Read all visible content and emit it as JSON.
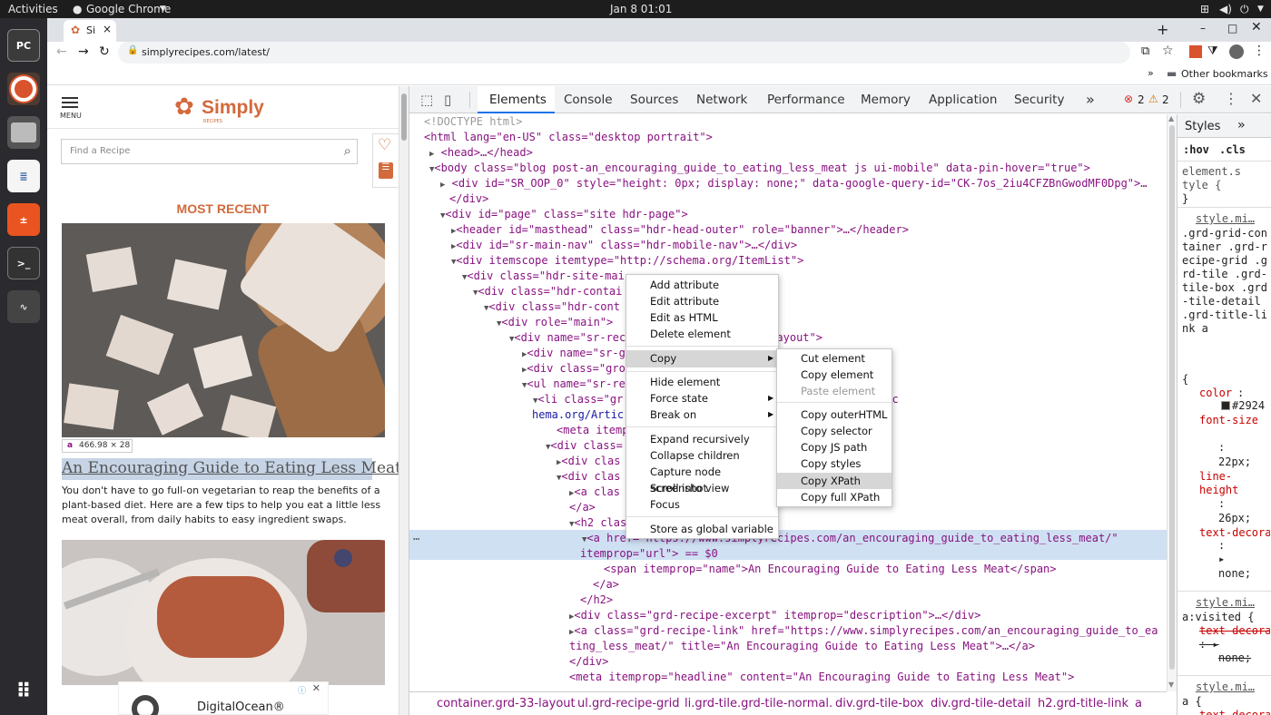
{
  "os": {
    "activities": "Activities",
    "app_menu": "Google Chrome",
    "clock": "Jan 8  01:01",
    "dock_apps": [
      "PC",
      "",
      "",
      "",
      "",
      ">_",
      ""
    ]
  },
  "browser": {
    "tab_title": "Si",
    "url": "simplyrecipes.com/latest/",
    "bookmarks_other": "Other bookmarks"
  },
  "page": {
    "menu_label": "MENU",
    "logo_text": "Simply",
    "logo_sub": "RECIPES",
    "search_placeholder": "Find a Recipe",
    "section_title": "MOST RECENT",
    "tooltip_tag": "a",
    "tooltip_size": "466.98 × 28",
    "article_title": "An Encouraging Guide to Eating Less Meat",
    "article_excerpt": "You don't have to go full-on vegetarian to reap the benefits of a plant-based diet. Here are a few tips to help you eat a little less meat overall, from daily habits to easy ingredient swaps.",
    "ad_title": "DigitalOcean®"
  },
  "devtools": {
    "tabs": [
      "Elements",
      "Console",
      "Sources",
      "Network",
      "Performance",
      "Memory",
      "Application",
      "Security"
    ],
    "more": "»",
    "errors": "2",
    "warnings": "2",
    "dom_lines": [
      "<!DOCTYPE html>",
      "<html lang=\"en-US\" class=\"desktop portrait\">",
      "<head>…</head>",
      "<body class=\"blog post-an_encouraging_guide_to_eating_less_meat js ui-mobile\" data-pin-hover=\"true\">",
      "<div id=\"SR_OOP_0\" style=\"height: 0px; display: none;\" data-google-query-id=\"CK-7os_2iu4CFZBnGwodMF0Dpg\">…",
      "</div>",
      "<div id=\"page\" class=\"site hdr-page\">",
      "<header id=\"masthead\" class=\"hdr-head-outer\" role=\"banner\">…</header>",
      "<div id=\"sr-main-nav\" class=\"hdr-mobile-nav\">…</div>",
      "<div itemscope itemtype=\"http://schema.org/ItemList\">",
      "<div class=\"hdr-site-mai",
      "<div class=\"hdr-contai",
      "<div class=\"hdr-cont",
      "<div role=\"main\">",
      "<div name=\"sr-rec                    rid-container  grd-33-layout\">",
      "<div name=\"sr-g                                     /div>",
      "<div class=\"gro",
      "<ul name=\"sr-re",
      "<li class=\"gr                      istElement\" itemscope itemtype=\"http://sc",
      "hema.org/Artic",
      "<meta itemp",
      "<div class=",
      "<div clas",
      "<div clas",
      "<a clas                                  mplyrecipes.com/author/katie-morford/\">…",
      "</a>",
      "<h2 clas",
      "<a href=\"https://www.simplyrecipes.com/an_encouraging_guide_to_eating_less_meat/\"",
      "itemprop=\"url\"> == $0",
      "<span itemprop=\"name\">An Encouraging Guide to Eating Less Meat</span>",
      "</a>",
      "</h2>",
      "<div class=\"grd-recipe-excerpt\" itemprop=\"description\">…</div>",
      "<a class=\"grd-recipe-link\" href=\"https://www.simplyrecipes.com/an_encouraging_guide_to_ea",
      "ting_less_meat/\" title=\"An Encouraging Guide to Eating Less Meat\">…</a>",
      "</div>",
      "<meta itemprop=\"headline\" content=\"An Encouraging Guide to Eating Less Meat\">"
    ],
    "breadcrumbs": [
      "container.grd-33-layout",
      "ul.grd-recipe-grid",
      "li.grd-tile.grd-tile-normal.",
      "div.grd-tile-box",
      "div.grd-tile-detail",
      "h2.grd-title-link",
      "a"
    ],
    "styles": {
      "tab": "Styles",
      "hov": ":hov",
      "cls": ".cls",
      "element_style": "element.s",
      "element_style2": "tyle {",
      "brace": "}",
      "src1": "style.mi…",
      "selector1": ".grd-grid-container .grd-recipe-grid .grd-tile .grd-tile-box .grd-tile-detail .grd-title-link a",
      "open": "{",
      "color_prop": "color",
      "color_val": "#2924",
      "fontsize_prop": "font-size",
      "fontsize_val": "22px;",
      "lineheight_prop": "line-height",
      "lineheight_val": "26px;",
      "textdec_prop": "text-decoration",
      "textdec_val": "none;",
      "src2": "style.mi…",
      "selector2": "a:visited {",
      "src3": "style.mi…",
      "selector3": "a {",
      "textdec_val2": "none;"
    }
  },
  "context_menu": {
    "items": [
      "Add attribute",
      "Edit attribute",
      "Edit as HTML",
      "Delete element",
      "Copy",
      "Hide element",
      "Force state",
      "Break on",
      "Expand recursively",
      "Collapse children",
      "Capture node screenshot",
      "Scroll into view",
      "Focus",
      "Store as global variable"
    ]
  },
  "copy_submenu": {
    "items": [
      "Cut element",
      "Copy element",
      "Paste element",
      "Copy outerHTML",
      "Copy selector",
      "Copy JS path",
      "Copy styles",
      "Copy XPath",
      "Copy full XPath"
    ]
  }
}
